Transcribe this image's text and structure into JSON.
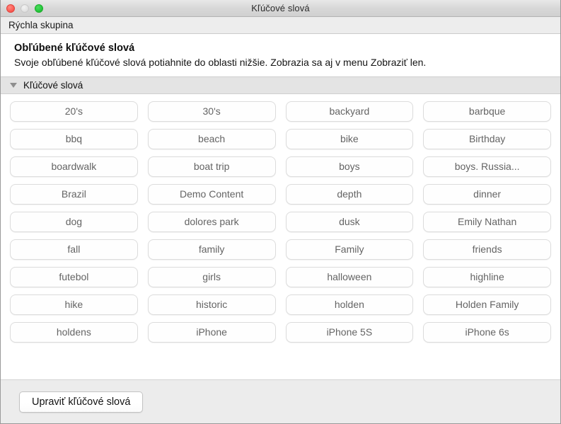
{
  "window": {
    "title": "Kľúčové slová",
    "traffic_lights": [
      {
        "name": "close",
        "color": "#fc6058",
        "enabled": true
      },
      {
        "name": "minimize",
        "color": "#e4e4e4",
        "enabled": false
      },
      {
        "name": "zoom",
        "color": "#28c940",
        "enabled": true
      }
    ]
  },
  "toolbar": {
    "quick_group_label": "Rýchla skupina"
  },
  "description": {
    "title": "Obľúbené kľúčové slová",
    "body": "Svoje obľúbené kľúčové slová potiahnite do oblasti nižšie. Zobrazia sa aj v menu Zobraziť len."
  },
  "section": {
    "title": "Kľúčové slová",
    "expanded": true,
    "disclosure_icon": "triangle-down-icon"
  },
  "keywords": [
    "20's",
    "30's",
    "backyard",
    "barbque",
    "bbq",
    "beach",
    "bike",
    "Birthday",
    "boardwalk",
    "boat trip",
    "boys",
    "boys. Russia...",
    "Brazil",
    "Demo Content",
    "depth",
    "dinner",
    "dog",
    "dolores park",
    "dusk",
    "Emily Nathan",
    "fall",
    "family",
    "Family",
    "friends",
    "futebol",
    "girls",
    "halloween",
    "highline",
    "hike",
    "historic",
    "holden",
    "Holden Family",
    "holdens",
    "iPhone",
    "iPhone 5S",
    "iPhone 6s"
  ],
  "footer": {
    "edit_button_label": "Upraviť kľúčové slová"
  }
}
